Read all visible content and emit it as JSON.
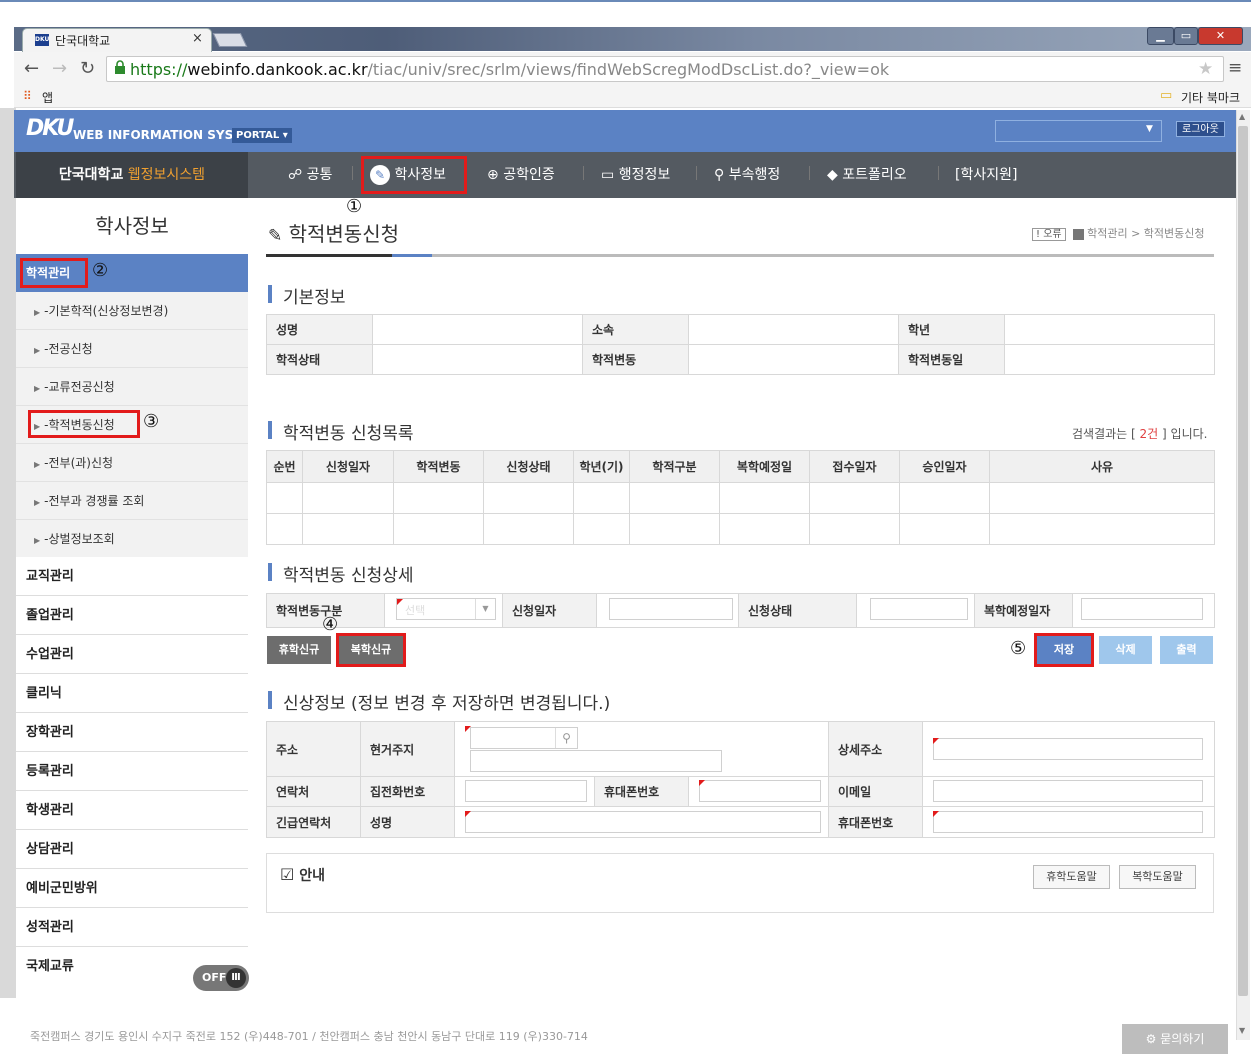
{
  "browser": {
    "tab_title": "단국대학교",
    "tab_favicon": "DKU",
    "tab_close": "×",
    "url_scheme": "https://",
    "url_host": "webinfo.dankook.ac.kr",
    "url_path": "/tiac/univ/srec/srlm/views/findWebScregModDscList.do?_view=ok",
    "bookmarks_apps": "앱",
    "bookmarks_other": "기타 북마크"
  },
  "portal": {
    "logo": "DKU",
    "system_name": "WEB INFORMATION SYSTEM",
    "portal_button": "PORTAL ▾",
    "logout": "로그아웃"
  },
  "menu": {
    "brand_prefix": "단국대학교",
    "brand_highlight": "웹정보시스템",
    "items": [
      "공통",
      "학사정보",
      "공학인증",
      "행정정보",
      "부속행정",
      "포트폴리오",
      "[학사지원]"
    ]
  },
  "markers": [
    "①",
    "②",
    "③",
    "④",
    "⑤"
  ],
  "sidebar": {
    "title": "학사정보",
    "active": "학적관리",
    "sub_items": [
      "-기본학적(신상정보변경)",
      "-전공신청",
      "-교류전공신청",
      "-학적변동신청",
      "-전부(과)신청",
      "-전부과 경쟁률 조회",
      "-상벌정보조회"
    ],
    "main_items": [
      "교직관리",
      "졸업관리",
      "수업관리",
      "클리닉",
      "장학관리",
      "등록관리",
      "학생관리",
      "상담관리",
      "예비군민방위",
      "성적관리",
      "국제교류"
    ],
    "toggle": "OFF"
  },
  "page": {
    "title": "학적변동신청",
    "breadcrumb_error": "오류",
    "breadcrumb_path": "학적관리 > 학적변동신청"
  },
  "basic_info": {
    "title": "기본정보",
    "labels": [
      "성명",
      "소속",
      "학년",
      "학적상태",
      "학적변동",
      "학적변동일"
    ]
  },
  "request_list": {
    "title": "학적변동 신청목록",
    "result_prefix": "검색결과는 [",
    "result_count": "2건",
    "result_suffix": "] 입니다.",
    "columns": [
      "순번",
      "신청일자",
      "학적변동",
      "신청상태",
      "학년(기)",
      "학적구분",
      "복학예정일",
      "접수일자",
      "승인일자",
      "사유"
    ]
  },
  "request_detail": {
    "title": "학적변동 신청상세",
    "labels": [
      "학적변동구분",
      "신청일자",
      "신청상태",
      "복학예정일자"
    ],
    "select_placeholder": "선택",
    "btn_leave": "휴학신규",
    "btn_return": "복학신규",
    "btn_save": "저장",
    "btn_delete": "삭제",
    "btn_print": "출력"
  },
  "personal_info": {
    "title": "신상정보 (정보 변경 후 저장하면 변경됩니다.)",
    "address": "주소",
    "current_address": "현거주지",
    "detail_address": "상세주소",
    "contact": "연락처",
    "home_phone": "집전화번호",
    "mobile": "휴대폰번호",
    "email": "이메일",
    "emergency": "긴급연락처",
    "name": "성명",
    "emergency_mobile": "휴대폰번호"
  },
  "guide": {
    "title": "안내",
    "btn_leave_help": "휴학도움말",
    "btn_return_help": "복학도움말"
  },
  "footer": {
    "address": "죽전캠퍼스 경기도 용인시 수지구 죽전로 152 (우)448-701 / 천안캠퍼스 충남 천안시 동남구 단대로 119 (우)330-714",
    "faq": "묻의하기"
  }
}
